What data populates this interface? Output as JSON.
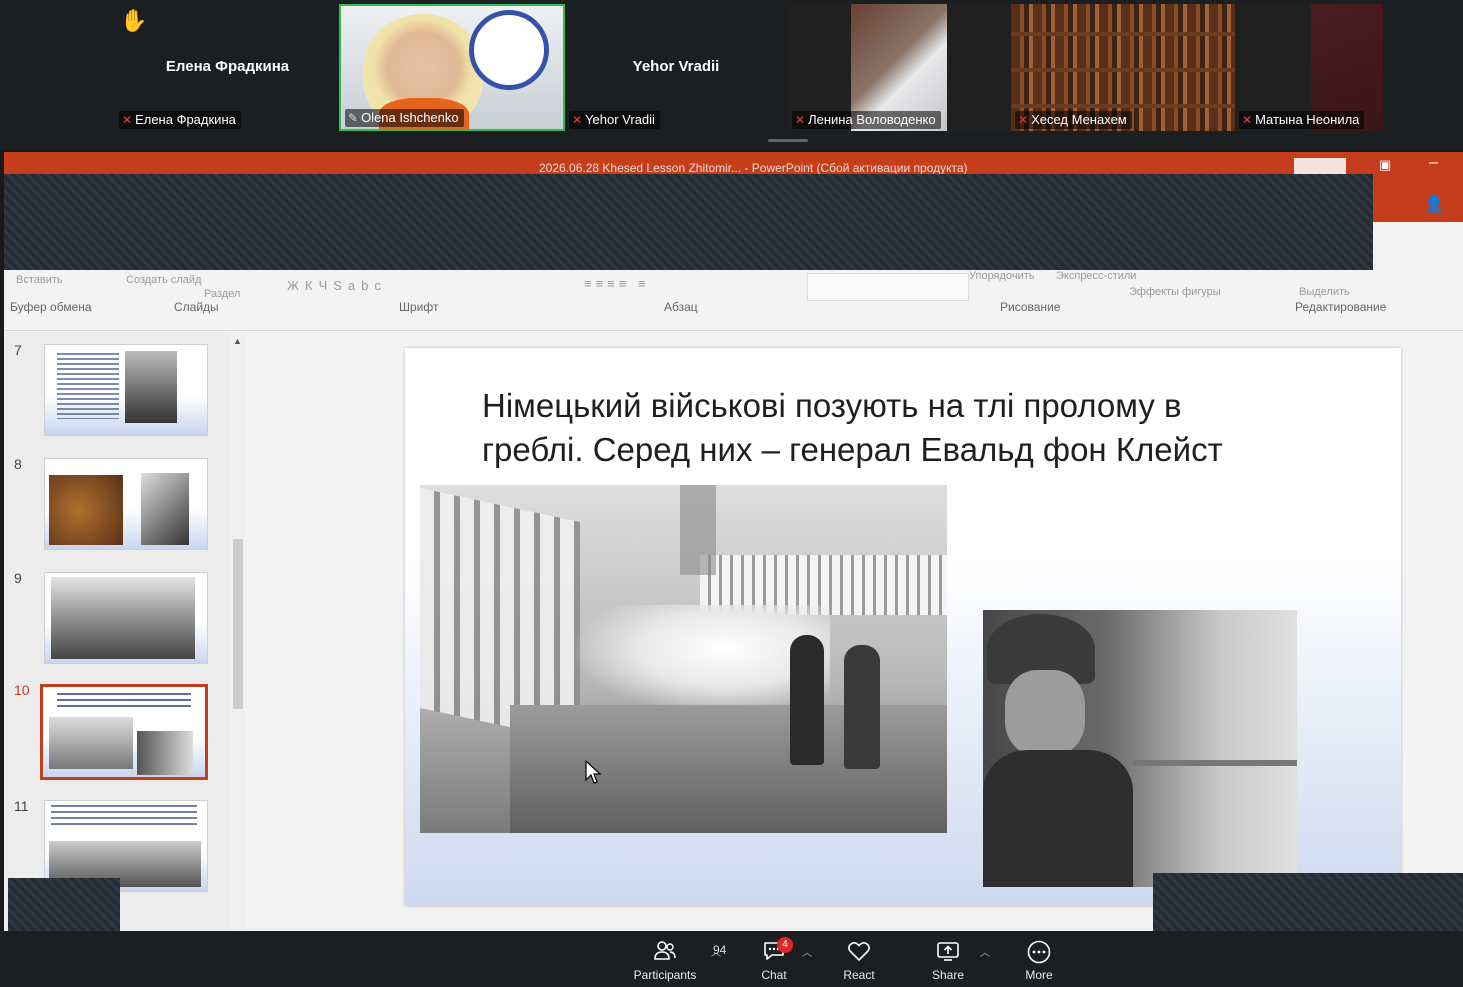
{
  "participants_strip": {
    "tiles": [
      {
        "big_name": "Елена Фрадкина",
        "label": "Елена Фрадкина",
        "muted": true
      },
      {
        "label": "Olena Ishchenko",
        "active_speaker": true
      },
      {
        "big_name": "Yehor Vradii",
        "label": "Yehor Vradii",
        "muted": true
      },
      {
        "label": "Ленина Воловоденко",
        "muted": true
      },
      {
        "label": "Хесед Менахем",
        "muted": true
      },
      {
        "label": "Матына Неонила",
        "muted": true
      }
    ]
  },
  "powerpoint": {
    "window_title": "2026.06.28 Khesed Lesson Zhitomir... - PowerPoint (Сбой активации продукта)",
    "ribbon": {
      "groups": [
        "Буфер обмена",
        "Слайды",
        "Шрифт",
        "Абзац",
        "Рисование",
        "Редактирование"
      ],
      "buttons": [
        "Вставить",
        "Создать слайд",
        "Раздел",
        "Упорядочить",
        "Экспресс-стили",
        "Эффекты фигуры",
        "Выделить"
      ]
    },
    "thumbnails": [
      {
        "num": "7"
      },
      {
        "num": "8"
      },
      {
        "num": "9"
      },
      {
        "num": "10",
        "selected": true
      },
      {
        "num": "11"
      }
    ],
    "slide": {
      "title_line1": "Німецький військові позують на тлі пролому в",
      "title_line2": "греблі. Серед них – генерал Евальд фон Клейст"
    }
  },
  "toolbar": {
    "participants": {
      "label": "Participants",
      "count": "94"
    },
    "chat": {
      "label": "Chat",
      "badge": "4"
    },
    "react": {
      "label": "React"
    },
    "share": {
      "label": "Share"
    },
    "more": {
      "label": "More"
    }
  },
  "colors": {
    "accent": "#c43e1c",
    "speaker_border": "#2ebd59",
    "mute": "#e04040"
  }
}
